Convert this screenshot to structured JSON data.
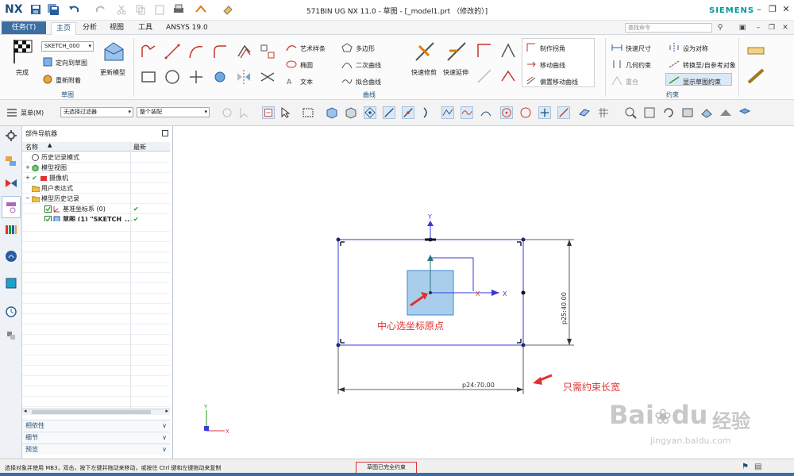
{
  "app": {
    "logo": "NX",
    "window_title": "571BIN UG NX 11.0 - 草图 - [_model1.prt （修改的）]",
    "brand": "SIEMENS",
    "search_placeholder": "查找命令"
  },
  "tabs": {
    "task_button": "任务(T)",
    "items": [
      "主页",
      "分析",
      "视图",
      "工具",
      "ANSYS 19.0"
    ]
  },
  "ribbon": {
    "sketch_group": {
      "finish_label": "完成",
      "sketch_name": "SKETCH_000",
      "orient_label": "定向到草图",
      "reattach_label": "重新附着",
      "update_model_label": "更新模型",
      "group_label": "草图"
    },
    "curve_group": {
      "items": [
        "艺术样条",
        "多边形",
        "椭圆",
        "二次曲线",
        "文本",
        "拟合曲线"
      ],
      "quick_trim": "快速修剪",
      "quick_extend": "快速延伸",
      "make_corner": "制作拐角",
      "move_curve": "移动曲线",
      "offset_move_curve": "偏置移动曲线",
      "group_label": "曲线"
    },
    "constraint_group": {
      "quick_dim": "快速尺寸",
      "geo_constraint": "几何约束",
      "set_symmetric": "设为对称",
      "convert_ref": "转换至/自参考对象",
      "show_constraints": "显示草图约束",
      "overlap": "重合",
      "group_label": "约束"
    }
  },
  "toolbar": {
    "menu_label": "菜单(M)",
    "filter_value": "无选择过滤器",
    "assembly_value": "整个装配"
  },
  "navigator": {
    "title": "部件导航器",
    "col_name": "名称",
    "col_latest": "最新",
    "tree": [
      {
        "label": "历史记录模式",
        "latest": ""
      },
      {
        "label": "模型视图",
        "latest": ""
      },
      {
        "label": "摄像机",
        "latest": ""
      },
      {
        "label": "用户表达式",
        "latest": ""
      },
      {
        "label": "模型历史记录",
        "latest": ""
      },
      {
        "label": "基准坐标系 (0)",
        "latest": "✔"
      },
      {
        "label": "草图 (1) \"SKETCH_...",
        "latest": "✔"
      }
    ],
    "accordions": [
      "相依性",
      "细节",
      "预览"
    ]
  },
  "canvas": {
    "annotation_center": "中心选坐标原点",
    "annotation_dims": "只需约束长宽",
    "dim_horizontal": "p24:70.00",
    "dim_vertical": "p25:40.00",
    "axis_y": "Y",
    "axis_x": "X"
  },
  "status": {
    "message": "选择对象并使用 MB3，双击，按下左键并拖动来移动，或按住 Ctrl 键和左键拖动来复制",
    "sketch_state": "草图已完全约束"
  },
  "watermark": {
    "brand": "Bai",
    "brand2": "du",
    "cn": "经验",
    "url": "jingyan.baidu.com"
  },
  "colors": {
    "accent": "#3c6ea4",
    "sketch_line": "#3a3adc",
    "annotation": "#e03131",
    "check": "#22a022"
  }
}
